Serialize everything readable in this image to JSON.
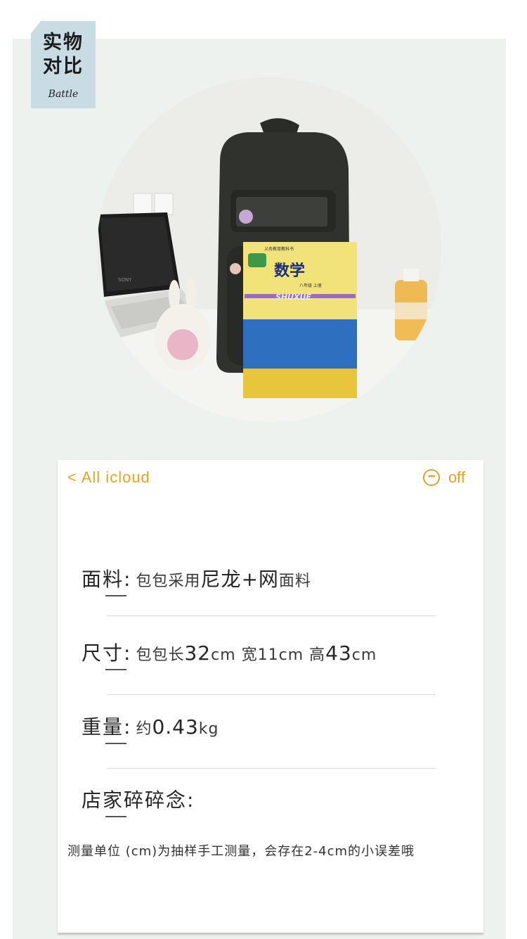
{
  "tag": {
    "title": "实物\n对比",
    "subtitle": "Battle"
  },
  "nav": {
    "back_label": "< All icloud",
    "off_label": "off"
  },
  "specs": [
    {
      "label": "面料:",
      "value_a": "包包采用",
      "value_big": "尼龙+网",
      "value_b": "面料"
    },
    {
      "label": "尺寸:",
      "value_a": "包包长",
      "value_big": "32",
      "value_b": "cm 宽11cm 高",
      "value_big2": "43",
      "value_c": "cm"
    },
    {
      "label": "重量:",
      "value_a": "约",
      "value_big": "0.43",
      "value_b": "kg"
    },
    {
      "label": "店家碎碎念:"
    }
  ],
  "note": "测量单位 (cm)为抽样手工测量，会存在2-4cm的小误差哦",
  "photo": {
    "laptop_text": "SONY",
    "book_title": "数学",
    "book_pinyin": "SHUXUE",
    "book_header": "义务教育教科书",
    "book_grade": "八年级  上册"
  }
}
